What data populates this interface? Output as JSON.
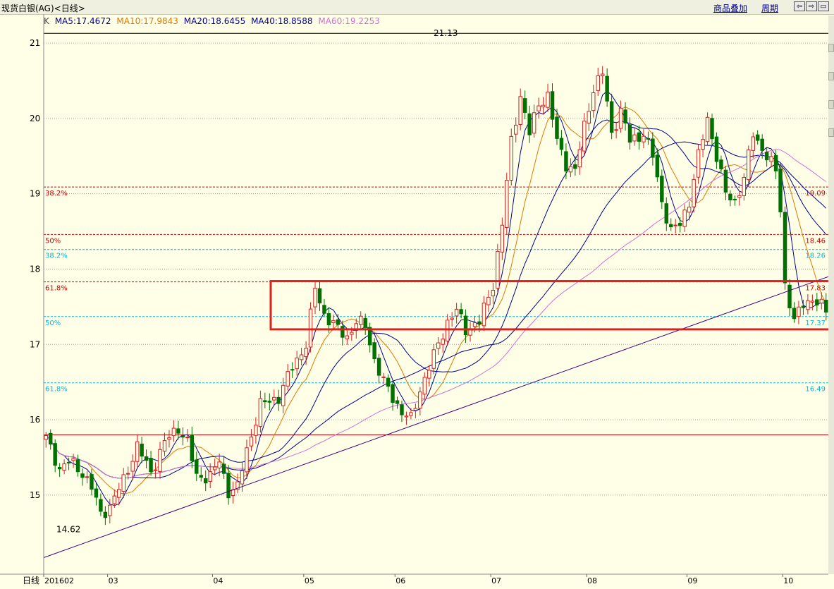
{
  "header": {
    "title": "现货白银(AG)<日线>",
    "overlay_label": "商品叠加",
    "period_label": "周期",
    "nav_buttons": [
      "⇦",
      "⇨",
      "▭"
    ]
  },
  "legend": {
    "k_label": "K",
    "items": [
      {
        "text": "MA5:17.4672",
        "color": "#00008b"
      },
      {
        "text": "MA10:17.9843",
        "color": "#e07800"
      },
      {
        "text": "MA20:18.6455",
        "color": "#00008b"
      },
      {
        "text": "MA40:18.8588",
        "color": "#00008b"
      },
      {
        "text": "MA60:19.2253",
        "color": "#d070d0"
      }
    ]
  },
  "colors": {
    "up": "#d02020",
    "down": "#007000",
    "fib_red": "#d00000",
    "fib_cyan": "#00b8d8",
    "grid": "#a0a090",
    "box": "#e02020",
    "trend": "#400080"
  },
  "chart_data": {
    "type": "candlestick",
    "title": "现货白银(AG)<日线>",
    "ylim": [
      14.1,
      21.45
    ],
    "yticks": [
      15,
      16,
      17,
      18,
      19,
      20,
      21
    ],
    "x_axis_label": "日线",
    "month_labels": [
      {
        "label": "201602",
        "index": 0
      },
      {
        "label": "03",
        "index": 14
      },
      {
        "label": "04",
        "index": 37
      },
      {
        "label": "05",
        "index": 57
      },
      {
        "label": "06",
        "index": 77
      },
      {
        "label": "07",
        "index": 98
      },
      {
        "label": "08",
        "index": 119
      },
      {
        "label": "09",
        "index": 141
      },
      {
        "label": "10",
        "index": 162
      }
    ],
    "num_candles": 172,
    "annotations": [
      {
        "text": "21.13",
        "value": 21.13
      },
      {
        "text": "14.62",
        "value": 14.62
      }
    ],
    "fib_levels": [
      {
        "left": "38.2%",
        "right": "19.09",
        "value": 19.09,
        "color": "red"
      },
      {
        "left": "50%",
        "right": "18.46",
        "value": 18.46,
        "color": "red"
      },
      {
        "left": "38.2%",
        "right": "18.26",
        "value": 18.26,
        "color": "cyan"
      },
      {
        "left": "61.8%",
        "right": "17.83",
        "value": 17.83,
        "color": "red"
      },
      {
        "left": "50%",
        "right": "17.37",
        "value": 17.37,
        "color": "cyan"
      },
      {
        "left": "61.8%",
        "right": "16.49",
        "value": 16.49,
        "color": "cyan"
      }
    ],
    "support_line": 15.8,
    "box_range": [
      17.2,
      17.84
    ],
    "trendline": {
      "from_value": 14.17,
      "to_value": 17.9
    },
    "anchors": [
      [
        0,
        15.75
      ],
      [
        3,
        15.35
      ],
      [
        5,
        15.45
      ],
      [
        8,
        15.3
      ],
      [
        10,
        15.1
      ],
      [
        12,
        14.75
      ],
      [
        14,
        14.85
      ],
      [
        17,
        15.2
      ],
      [
        20,
        15.65
      ],
      [
        23,
        15.3
      ],
      [
        26,
        15.7
      ],
      [
        29,
        15.9
      ],
      [
        31,
        15.7
      ],
      [
        33,
        15.25
      ],
      [
        36,
        15.25
      ],
      [
        38,
        15.45
      ],
      [
        40,
        15.05
      ],
      [
        42,
        15.1
      ],
      [
        44,
        15.6
      ],
      [
        47,
        16.2
      ],
      [
        51,
        16.3
      ],
      [
        54,
        16.7
      ],
      [
        57,
        17.0
      ],
      [
        59,
        17.75
      ],
      [
        61,
        17.4
      ],
      [
        64,
        17.2
      ],
      [
        66,
        17.1
      ],
      [
        68,
        17.3
      ],
      [
        70,
        17.25
      ],
      [
        72,
        16.8
      ],
      [
        74,
        16.5
      ],
      [
        76,
        16.3
      ],
      [
        78,
        16.1
      ],
      [
        80,
        16.0
      ],
      [
        82,
        16.4
      ],
      [
        84,
        16.7
      ],
      [
        86,
        17.0
      ],
      [
        88,
        17.3
      ],
      [
        90,
        17.45
      ],
      [
        92,
        17.2
      ],
      [
        95,
        17.3
      ],
      [
        98,
        17.8
      ],
      [
        100,
        18.6
      ],
      [
        102,
        19.7
      ],
      [
        104,
        20.3
      ],
      [
        106,
        19.8
      ],
      [
        108,
        20.2
      ],
      [
        110,
        20.3
      ],
      [
        112,
        19.7
      ],
      [
        114,
        19.4
      ],
      [
        116,
        19.3
      ],
      [
        118,
        19.9
      ],
      [
        120,
        20.4
      ],
      [
        122,
        20.6
      ],
      [
        124,
        19.8
      ],
      [
        126,
        20.1
      ],
      [
        128,
        19.7
      ],
      [
        131,
        19.8
      ],
      [
        133,
        19.5
      ],
      [
        135,
        18.9
      ],
      [
        137,
        18.5
      ],
      [
        139,
        18.6
      ],
      [
        141,
        18.9
      ],
      [
        143,
        19.5
      ],
      [
        145,
        20.0
      ],
      [
        147,
        19.5
      ],
      [
        149,
        19.0
      ],
      [
        151,
        18.9
      ],
      [
        153,
        19.2
      ],
      [
        155,
        19.8
      ],
      [
        157,
        19.6
      ],
      [
        159,
        19.4
      ],
      [
        160,
        19.3
      ],
      [
        161,
        18.8
      ],
      [
        162,
        17.8
      ],
      [
        164,
        17.3
      ],
      [
        166,
        17.55
      ],
      [
        168,
        17.6
      ],
      [
        171,
        17.45
      ]
    ]
  }
}
